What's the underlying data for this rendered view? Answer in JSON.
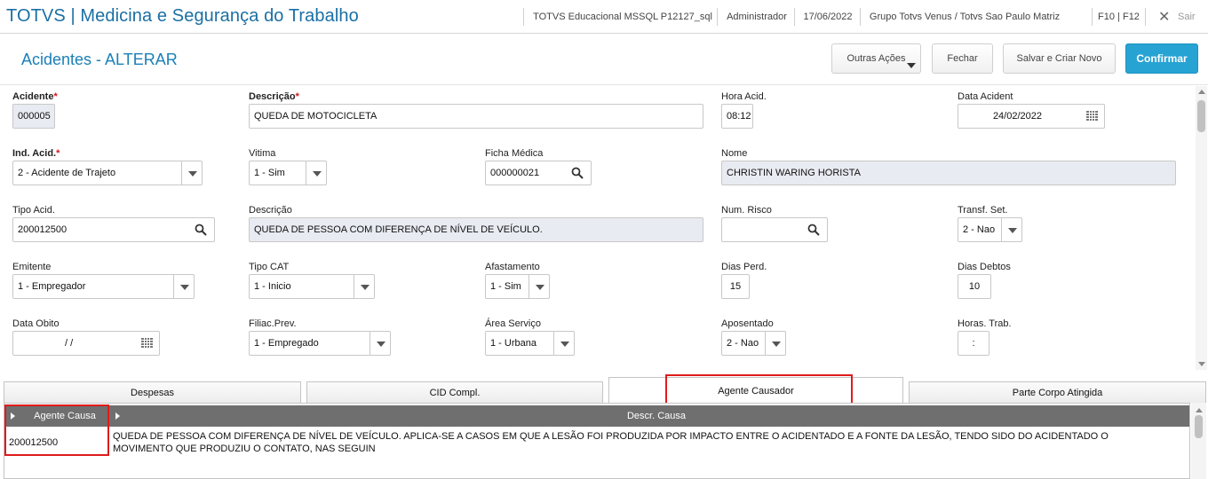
{
  "header": {
    "app_title": "TOTVS | Medicina e Segurança do Trabalho",
    "environment": "TOTVS Educacional MSSQL P12127_sql",
    "user": "Administrador",
    "date": "17/06/2022",
    "company": "Grupo Totvs Venus / Totvs Sao Paulo Matriz",
    "shortcut": "F10 | F12",
    "exit_label": "Sair"
  },
  "page": {
    "title": "Acidentes - ALTERAR",
    "buttons": {
      "other_actions": "Outras Ações",
      "close": "Fechar",
      "save_new": "Salvar e Criar Novo",
      "confirm": "Confirmar"
    }
  },
  "form": {
    "acidente": {
      "label": "Acidente",
      "value": "000005",
      "required": true
    },
    "descricao": {
      "label": "Descrição",
      "value": "QUEDA DE MOTOCICLETA",
      "required": true
    },
    "hora_acid": {
      "label": "Hora Acid.",
      "value": "08:12"
    },
    "data_acident": {
      "label": "Data Acident",
      "value": "24/02/2022"
    },
    "ind_acid": {
      "label": "Ind. Acid.",
      "value": "2 - Acidente de Trajeto",
      "required": true
    },
    "vitima": {
      "label": "Vitima",
      "value": "1 - Sim"
    },
    "ficha_medica": {
      "label": "Ficha Médica",
      "value": "000000021"
    },
    "nome": {
      "label": "Nome",
      "value": "CHRISTIN WARING HORISTA"
    },
    "tipo_acid": {
      "label": "Tipo Acid.",
      "value": "200012500"
    },
    "descricao_tipo": {
      "label": "Descrição",
      "value": "QUEDA DE PESSOA COM DIFERENÇA DE NÍVEL DE VEÍCULO."
    },
    "num_risco": {
      "label": "Num. Risco",
      "value": ""
    },
    "transf_set": {
      "label": "Transf. Set.",
      "value": "2 - Nao"
    },
    "emitente": {
      "label": "Emitente",
      "value": "1 - Empregador"
    },
    "tipo_cat": {
      "label": "Tipo CAT",
      "value": "1 - Inicio"
    },
    "afastamento": {
      "label": "Afastamento",
      "value": "1 - Sim"
    },
    "dias_perd": {
      "label": "Dias Perd.",
      "value": "15"
    },
    "dias_debtos": {
      "label": "Dias Debtos",
      "value": "10"
    },
    "data_obito": {
      "label": "Data Obito",
      "value": "/ /"
    },
    "filiac_prev": {
      "label": "Filiac.Prev.",
      "value": "1 - Empregado"
    },
    "area_servico": {
      "label": "Área Serviço",
      "value": "1 - Urbana"
    },
    "aposentado": {
      "label": "Aposentado",
      "value": "2 - Nao"
    },
    "horas_trab": {
      "label": "Horas. Trab.",
      "value": ":"
    }
  },
  "tabs": [
    {
      "label": "Despesas"
    },
    {
      "label": "CID Compl."
    },
    {
      "label": "Agente Causador",
      "active": true
    },
    {
      "label": "Parte Corpo Atingida"
    }
  ],
  "grid": {
    "columns": [
      "Agente Causa",
      "Descr. Causa"
    ],
    "rows": [
      {
        "agente_causa": "200012500",
        "descr_causa": "QUEDA DE PESSOA COM DIFERENÇA DE NÍVEL DE VEÍCULO. APLICA-SE A CASOS EM QUE A LESÃO FOI PRODUZIDA POR IMPACTO ENTRE O ACIDENTADO E A FONTE DA LESÃO, TENDO SIDO DO ACIDENTADO O MOVIMENTO QUE PRODUZIU O CONTATO, NAS SEGUIN"
      }
    ]
  },
  "colors": {
    "brand": "#1a6fa4",
    "accent": "#27a3d3",
    "required": "#d3141a",
    "highlight": "#e01b1b",
    "readonly_bg": "#e8ebf1",
    "grid_header": "#6f6f6f"
  },
  "icons": {
    "search": "search-icon",
    "calendar": "calendar-icon",
    "dropdown": "chevron-down-icon",
    "close": "close-icon"
  }
}
